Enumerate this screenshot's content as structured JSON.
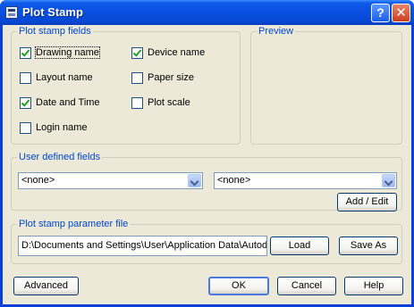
{
  "window": {
    "title": "Plot Stamp"
  },
  "stamp_fields": {
    "label": "Plot stamp fields",
    "items": [
      {
        "id": "drawing-name",
        "label": "Drawing name",
        "checked": true,
        "focused": true
      },
      {
        "id": "device-name",
        "label": "Device name",
        "checked": true
      },
      {
        "id": "layout-name",
        "label": "Layout name",
        "checked": false
      },
      {
        "id": "paper-size",
        "label": "Paper size",
        "checked": false
      },
      {
        "id": "date-and-time",
        "label": "Date and Time",
        "checked": true
      },
      {
        "id": "plot-scale",
        "label": "Plot scale",
        "checked": false
      },
      {
        "id": "login-name",
        "label": "Login name",
        "checked": false
      }
    ]
  },
  "preview": {
    "label": "Preview"
  },
  "user_fields": {
    "label": "User defined fields",
    "combo1": "<none>",
    "combo2": "<none>",
    "add_edit": "Add / Edit"
  },
  "param_file": {
    "label": "Plot stamp parameter file",
    "path": "D:\\Documents and Settings\\User\\Application Data\\Autodesk",
    "load": "Load",
    "save_as": "Save As"
  },
  "footer": {
    "advanced": "Advanced",
    "ok": "OK",
    "cancel": "Cancel",
    "help": "Help"
  }
}
